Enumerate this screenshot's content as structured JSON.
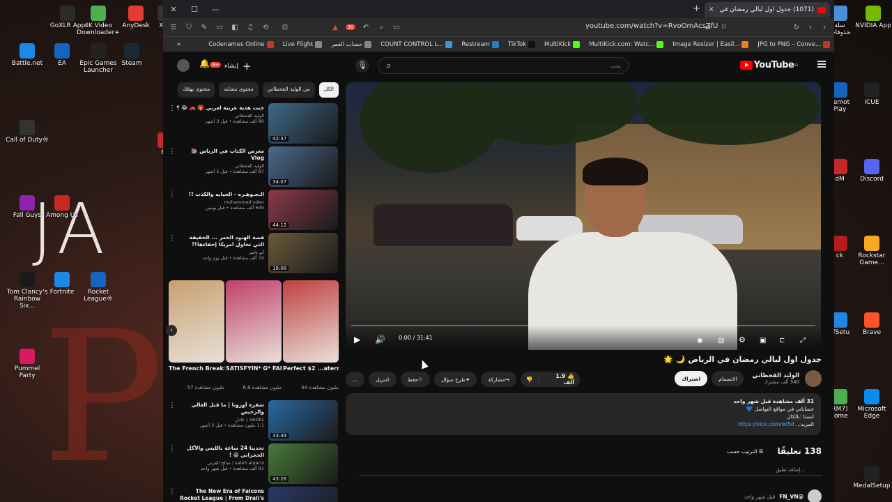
{
  "desktop": {
    "icons_left": [
      {
        "label": "GoXLR App",
        "color": "#2a2a2a"
      },
      {
        "label": "4K Video Downloader+",
        "color": "#4caf50"
      },
      {
        "label": "AnyDesk",
        "color": "#e53935"
      },
      {
        "label": "X11",
        "color": "#333"
      },
      {
        "label": "Battle.net",
        "color": "#1e88e5"
      },
      {
        "label": "EA",
        "color": "#1565c0"
      },
      {
        "label": "Epic Games Launcher",
        "color": "#222"
      },
      {
        "label": "Steam",
        "color": "#1b2838"
      },
      {
        "label": "Call of Duty®",
        "color": "#333"
      },
      {
        "label": "EA",
        "color": "#c62828"
      },
      {
        "label": "Fall Guys",
        "color": "#8e24aa"
      },
      {
        "label": "Among Us",
        "color": "#c62828"
      },
      {
        "label": "Tom Clancy's Rainbow Six...",
        "color": "#1a1a1a"
      },
      {
        "label": "Fortnite",
        "color": "#1e88e5"
      },
      {
        "label": "Rocket League®",
        "color": "#1565c0"
      },
      {
        "label": "Pummel Party",
        "color": "#d81b60"
      }
    ],
    "icons_right": [
      {
        "label": "سلة المحذوفات",
        "color": "#4a90d9"
      },
      {
        "label": "NVIDIA App",
        "color": "#76b900"
      },
      {
        "label": "Remote Play",
        "color": "#1565c0"
      },
      {
        "label": "iCUE",
        "color": "#222"
      },
      {
        "label": "dM",
        "color": "#c62828"
      },
      {
        "label": "Discord",
        "color": "#5865f2"
      },
      {
        "label": "ck",
        "color": "#b71c1c"
      },
      {
        "label": "Rockstar Game...",
        "color": "#f9a825"
      },
      {
        "label": "ofSetup",
        "color": "#1e88e5"
      },
      {
        "label": "Brave",
        "color": "#fb542b"
      },
      {
        "label": "RM7) rome",
        "color": "#4caf50"
      },
      {
        "label": "Microsoft Edge",
        "color": "#0c8ce9"
      },
      {
        "label": "MedalSetup",
        "color": "#222"
      }
    ]
  },
  "browser": {
    "tab_title": "(1071) جدول اول ليالي رمضان في",
    "url": "youtube.com/watch?v=RvoOmAcsZfU",
    "shield_badge": "30",
    "bookmarks": [
      {
        "label": "Codenames Online",
        "color": "#c0392b"
      },
      {
        "label": "Live Flight",
        "color": "#888"
      },
      {
        "label": "حساب العمر",
        "color": "#888"
      },
      {
        "label": "COUNT CONTROL L...",
        "color": "#3498db"
      },
      {
        "label": "Restream",
        "color": "#2980b9"
      },
      {
        "label": "TikTok",
        "color": "#111"
      },
      {
        "label": "MultiKick",
        "color": "#53fc18"
      },
      {
        "label": "MultiKick.com: Watc...",
        "color": "#53fc18"
      },
      {
        "label": "Image Resizer | Easil...",
        "color": "#e67e22"
      },
      {
        "label": "JPG to PNG – Conve...",
        "color": "#c0392b"
      },
      {
        "label": "القرآن الكريم",
        "color": "#888"
      }
    ]
  },
  "youtube": {
    "logo_text": "YouTube",
    "logo_country": "SA",
    "search_placeholder": "بحث",
    "create_label": "إنشاء",
    "notif_count": "9+",
    "chips": [
      "الكل",
      "من الوليد الفحطاني",
      "محتوى مشابه",
      "محتوى يهمّك"
    ],
    "player": {
      "time": "0:00 / 31:41",
      "progress": 0
    },
    "video": {
      "title": "جدول اول ليالي رمضان في الرياض 🌙 🌟",
      "channel": "الوليد القحطاني",
      "subs": "340 ألف مشترك",
      "join_label": "الانضمام",
      "subscribe_label": "اشتراك",
      "likes": "1.9 ألف",
      "share_label": "مشاركة",
      "ask_label": "طرح سؤال",
      "save_label": "حفظ",
      "download_label": "تنزيل",
      "more_label": "...",
      "desc_views": "31 ألف مشاهدة قبل شهر واحد",
      "desc_line1": "حساباتي في مواقع التواصل 💙",
      "desc_line2": "انستا :بالكال",
      "desc_more": "المزيد...",
      "desc_link": "https://kick.com/wl5d"
    },
    "comments": {
      "count": "138 تعليقًا",
      "sort_label": "الترتيب حسب",
      "add_placeholder": "إضافة تعليق...",
      "first_user": "@FN_VN",
      "first_time": "قبل شهر واحد"
    },
    "sidebar": [
      {
        "title": "جبت هدية عربية لعربي 🎁 🚗 😂 ؟",
        "channel": "الوليد القحطاني",
        "views": "80 ألف مشاهدة • قبل 3 أشهر",
        "duration": "42:37",
        "thumb": "#3d6a8a"
      },
      {
        "title": "معرض الكتاب في الرياض 📚 Vlog",
        "channel": "الوليد القحطاني",
        "views": "87 ألف مشاهدة • قبل 5 أشهر",
        "duration": "34:07",
        "thumb": "#4a6a8c"
      },
      {
        "title": "الـجـوهـره - الحيايه والكذب !!",
        "channel": "mohammed oden",
        "views": "649 ألف مشاهدة • قبل يومين",
        "duration": "44:12",
        "thumb": "#8a3a4a"
      },
      {
        "title": "قصة الهنود الحمر ... الحقيقة التي تحاول امريكا إخفاءها؟!",
        "channel": "أبو ناصر",
        "views": "74 ألف مشاهدة • قبل يوم واحد",
        "duration": "18:08",
        "thumb": "#6a5a3a"
      },
      {
        "title": "سفرة أوروبا | ما قبل الغالي والرخيص",
        "channel": "3ADEL | عادل",
        "views": "1.1 مليون مشاهدة • قبل 3 أشهر",
        "duration": "33:49",
        "thumb": "#2a6aa0"
      },
      {
        "title": "تحدينا 24 ساعة بالليس والأكل الحجراني 😁 !",
        "channel": "saleh alqarni | صالح القرني",
        "views": "91 ألف مشاهدة • قبل شهر واحد",
        "duration": "43:26",
        "thumb": "#4a7a3a"
      },
      {
        "title": "The New Era of Falcons Rocket League | From Drali's Arrival to",
        "channel": "",
        "views": "",
        "duration": "",
        "thumb": "#2a3a6a"
      }
    ],
    "shorts": [
      {
        "title": "The French Breakfast! ...",
        "views": "57 مليون مشاهدة",
        "color": "#c8a070"
      },
      {
        "title": "SATISFYIN* G* FANTA ...",
        "views": "6.8 مليون مشاهدة",
        "color": "#c0406a"
      },
      {
        "title": "Perfect $2 ...atermelon",
        "views": "64 مليون مشاهدة",
        "color": "#c04040"
      }
    ]
  }
}
